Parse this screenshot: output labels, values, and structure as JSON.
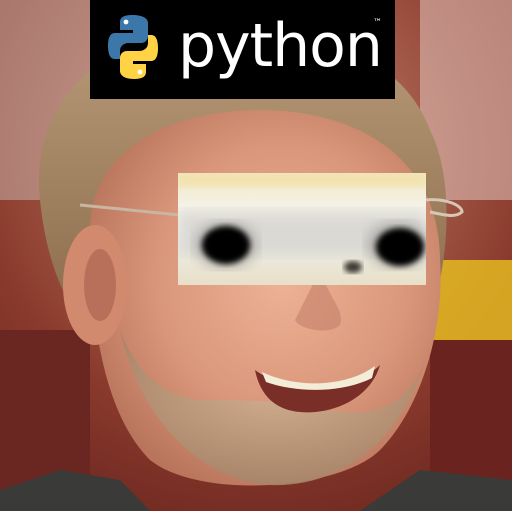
{
  "logo": {
    "wordmark": "python",
    "trademark": "™",
    "colors": {
      "blue": "#3b77a8",
      "yellow": "#ffd343",
      "background": "#000000",
      "text": "#ffffff"
    }
  },
  "photo": {
    "icons": [
      "python-logo-icon"
    ],
    "colors": {
      "skin": "#d9967a",
      "beard": "#b58e6e",
      "hair": "#9a7a58",
      "background_red": "#7a2a22",
      "background_yellow": "#e8c020"
    }
  }
}
